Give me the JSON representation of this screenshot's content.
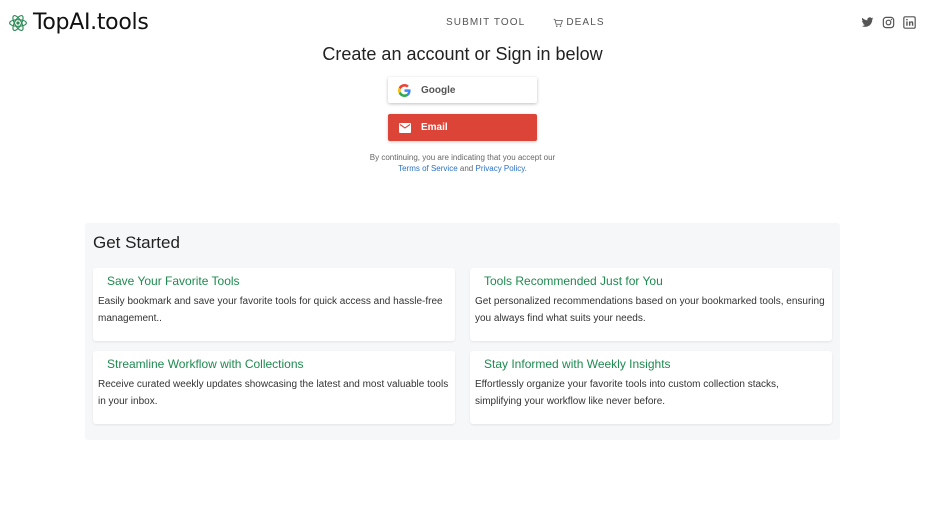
{
  "header": {
    "logo_text": "TopAI.tools",
    "logo_icon": "atom-logo-icon",
    "nav": {
      "submit_tool": "SUBMIT TOOL",
      "deals": "DEALS"
    },
    "socials": [
      "twitter-icon",
      "instagram-icon",
      "linkedin-icon"
    ]
  },
  "signin": {
    "title": "Create an account or Sign in below",
    "google_label": "Google",
    "email_label": "Email",
    "terms_prefix": "By continuing, you are indicating that you accept our",
    "terms_link": "Terms of Service",
    "terms_and": "and",
    "privacy_link": "Privacy Policy."
  },
  "get_started": {
    "title": "Get Started",
    "cards": [
      {
        "title": "Save Your Favorite Tools",
        "desc": "Easily bookmark and save your favorite tools for quick access and hassle-free management.."
      },
      {
        "title": "Tools Recommended Just for You",
        "desc": "Get personalized recommendations based on your bookmarked tools, ensuring you always find what suits your needs."
      },
      {
        "title": "Streamline Workflow with Collections",
        "desc": "Receive curated weekly updates showcasing the latest and most valuable tools in your inbox."
      },
      {
        "title": "Stay Informed with Weekly Insights",
        "desc": "Effortlessly organize your favorite tools into custom collection stacks, simplifying your workflow like never before."
      }
    ]
  },
  "colors": {
    "accent_green": "#1e8a4f",
    "email_red": "#db4437",
    "link_blue": "#2a72c9",
    "panel_bg": "#f6f7f9"
  }
}
